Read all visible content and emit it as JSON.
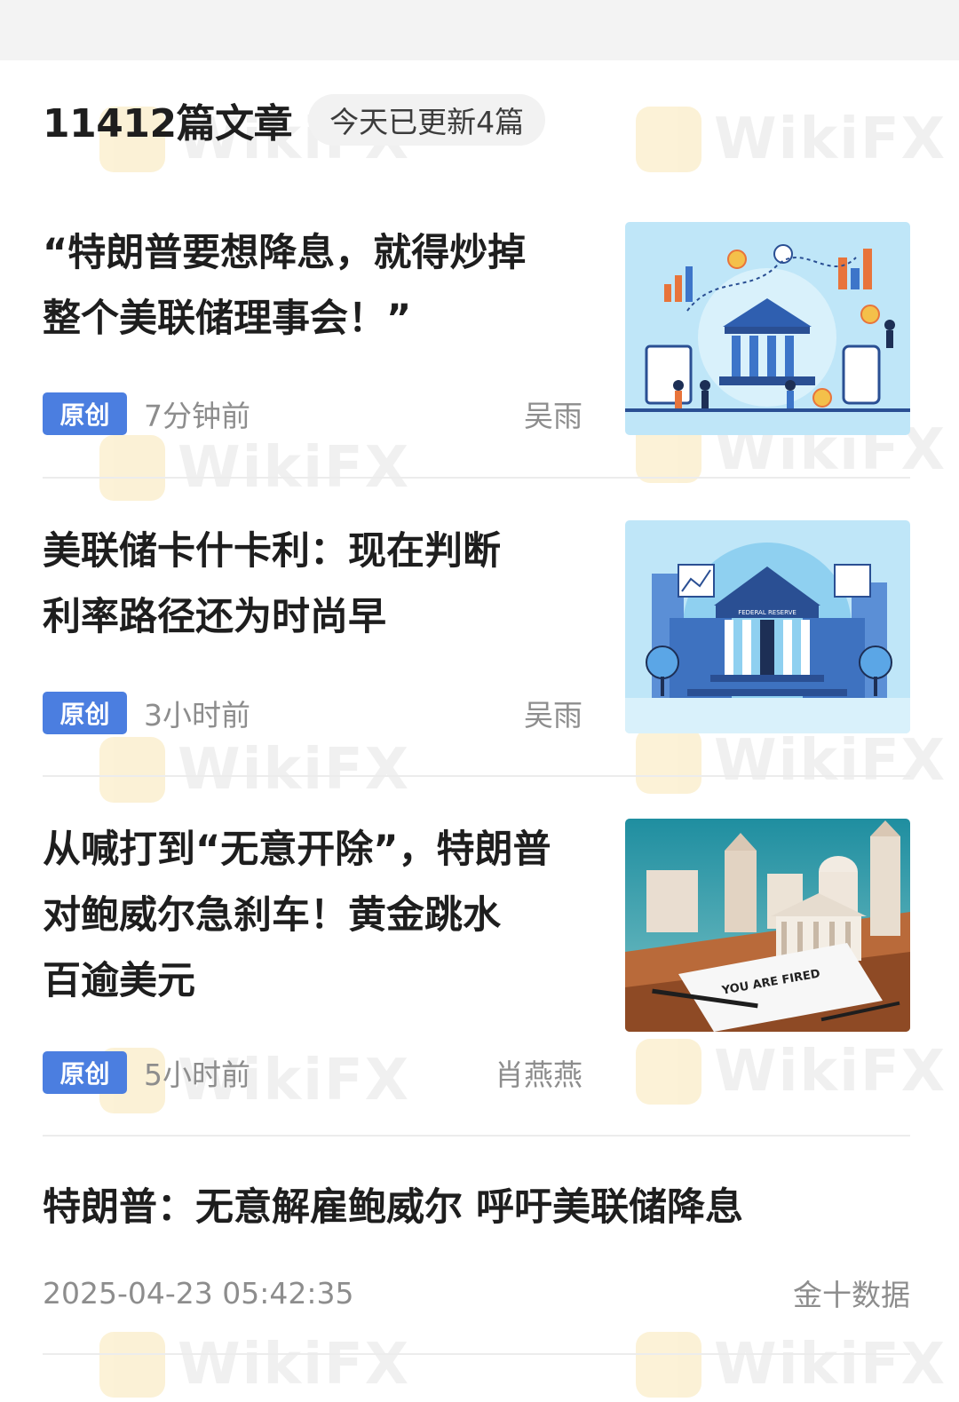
{
  "header": {
    "article_count": "11412篇文章",
    "updated_today": "今天已更新4篇"
  },
  "articles": [
    {
      "title_line1": "“特朗普要想降息，就得炒掉",
      "title_line2": "整个美联储理事会！”",
      "badge": "原创",
      "time": "7分钟前",
      "author": "吴雨",
      "thumbnail": "finance-infographic-thumbnail"
    },
    {
      "title_line1": "美联储卡什卡利：现在判断",
      "title_line2": "利率路径还为时尚早",
      "badge": "原创",
      "time": "3小时前",
      "author": "吴雨",
      "thumbnail": "federal-reserve-building-thumbnail",
      "thumb_sign": "FEDERAL RESERVE"
    },
    {
      "title_line1": "从喊打到“无意开除”，特朗普",
      "title_line2": "对鲍威尔急刹车！黄金跳水",
      "title_line3": "百逾美元",
      "badge": "原创",
      "time": "5小时前",
      "author": "肖燕燕",
      "thumbnail": "you-are-fired-desk-thumbnail",
      "thumb_paper": "YOU ARE FIRED"
    }
  ],
  "plain_article": {
    "title": "特朗普：无意解雇鲍威尔 呼吁美联储降息",
    "date": "2025-04-23 05:42:35",
    "source": "金十数据"
  },
  "watermark_text": "WikiFX",
  "colors": {
    "badge": "#4b7ee0",
    "meta_text": "#8d8d8d",
    "title_text": "#1e1e1e",
    "thumb_bg": "#b9e4f7"
  }
}
